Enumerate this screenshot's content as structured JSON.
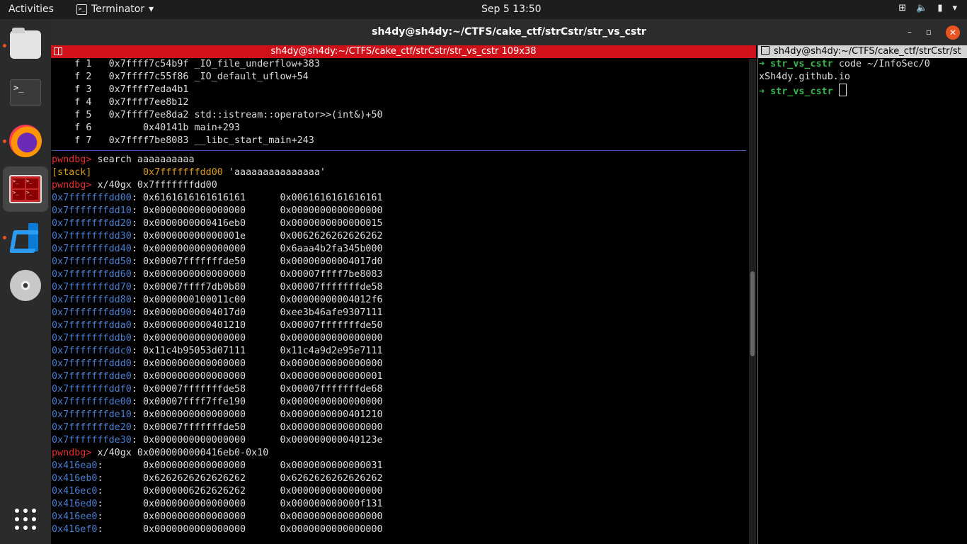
{
  "topbar": {
    "activities": "Activities",
    "app_name": "Terminator",
    "clock": "Sep 5  13:50",
    "network_icon": "network-icon",
    "volume_icon": "volume-icon",
    "battery_icon": "battery-icon",
    "power_icon": "power-menu-icon"
  },
  "window": {
    "title": "sh4dy@sh4dy:~/CTFS/cake_ctf/strCstr/str_vs_cstr",
    "minimize": "–",
    "maximize": "▫",
    "close": "✕"
  },
  "left_pane": {
    "title": "sh4dy@sh4dy:~/CTFS/cake_ctf/strCstr/str_vs_cstr 109x38",
    "backtrace": [
      "    f 1   0x7ffff7c54b9f _IO_file_underflow+383",
      "    f 2   0x7ffff7c55f86 _IO_default_uflow+54",
      "    f 3   0x7ffff7eda4b1",
      "    f 4   0x7ffff7ee8b12",
      "    f 5   0x7ffff7ee8da2 std::istream::operator>>(int&)+50",
      "    f 6         0x40141b main+293",
      "    f 7   0x7ffff7be8083 __libc_start_main+243"
    ],
    "prompt": "pwndbg> ",
    "cmd1": "search aaaaaaaaaa",
    "search_tag": "[stack]",
    "search_addr": "0x7fffffffdd00",
    "search_val": " 'aaaaaaaaaaaaaaa'",
    "cmd2": "x/40gx 0x7fffffffdd00",
    "dump1": [
      {
        "a": "0x7fffffffdd00",
        "v": ": 0x6161616161616161      0x0061616161616161"
      },
      {
        "a": "0x7fffffffdd10",
        "v": ": 0x0000000000000000      0x0000000000000000"
      },
      {
        "a": "0x7fffffffdd20",
        "v": ": 0x0000000000416eb0      0x0000000000000015"
      },
      {
        "a": "0x7fffffffdd30",
        "v": ": 0x000000000000001e      0x0062626262626262"
      },
      {
        "a": "0x7fffffffdd40",
        "v": ": 0x0000000000000000      0x6aaa4b2fa345b000"
      },
      {
        "a": "0x7fffffffdd50",
        "v": ": 0x00007fffffffde50      0x00000000004017d0"
      },
      {
        "a": "0x7fffffffdd60",
        "v": ": 0x0000000000000000      0x00007ffff7be8083"
      },
      {
        "a": "0x7fffffffdd70",
        "v": ": 0x00007ffff7db0b80      0x00007fffffffde58"
      },
      {
        "a": "0x7fffffffdd80",
        "v": ": 0x0000000100011c00      0x00000000004012f6"
      },
      {
        "a": "0x7fffffffdd90",
        "v": ": 0x00000000004017d0      0xee3b46afe9307111"
      },
      {
        "a": "0x7fffffffdda0",
        "v": ": 0x0000000000401210      0x00007fffffffde50"
      },
      {
        "a": "0x7fffffffddb0",
        "v": ": 0x0000000000000000      0x0000000000000000"
      },
      {
        "a": "0x7fffffffddc0",
        "v": ": 0x11c4b95053d07111      0x11c4a9d2e95e7111"
      },
      {
        "a": "0x7fffffffddd0",
        "v": ": 0x0000000000000000      0x0000000000000000"
      },
      {
        "a": "0x7fffffffdde0",
        "v": ": 0x0000000000000000      0x0000000000000001"
      },
      {
        "a": "0x7fffffffddf0",
        "v": ": 0x00007fffffffde58      0x00007fffffffde68"
      },
      {
        "a": "0x7fffffffde00",
        "v": ": 0x00007ffff7ffe190      0x0000000000000000"
      },
      {
        "a": "0x7fffffffde10",
        "v": ": 0x0000000000000000      0x0000000000401210"
      },
      {
        "a": "0x7fffffffde20",
        "v": ": 0x00007fffffffde50      0x0000000000000000"
      },
      {
        "a": "0x7fffffffde30",
        "v": ": 0x0000000000000000      0x000000000040123e"
      }
    ],
    "cmd3": "x/40gx 0x0000000000416eb0-0x10",
    "dump2": [
      {
        "a": "0x416ea0",
        "v": ":       0x0000000000000000      0x0000000000000031"
      },
      {
        "a": "0x416eb0",
        "v": ":       0x6262626262626262      0x6262626262626262"
      },
      {
        "a": "0x416ec0",
        "v": ":       0x0000006262626262      0x0000000000000000"
      },
      {
        "a": "0x416ed0",
        "v": ":       0x0000000000000000      0x000000000000f131"
      },
      {
        "a": "0x416ee0",
        "v": ":       0x0000000000000000      0x0000000000000000"
      },
      {
        "a": "0x416ef0",
        "v": ":       0x0000000000000000      0x0000000000000000"
      }
    ]
  },
  "right_pane": {
    "title": "sh4dy@sh4dy:~/CTFS/cake_ctf/strCstr/st",
    "arrow": "➜ ",
    "dir": "str_vs_cstr",
    "line1_rest": " code ~/InfoSec/0",
    "line2": "xSh4dy.github.io",
    "line3_rest": " "
  }
}
